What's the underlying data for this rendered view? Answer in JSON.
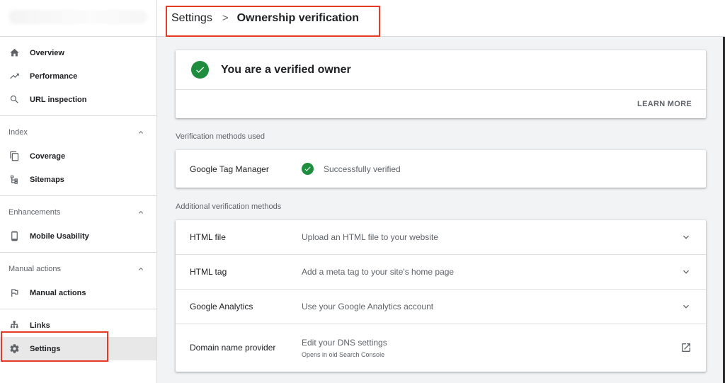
{
  "sidebar": {
    "top_items": [
      {
        "label": "Overview",
        "icon": "home-icon"
      },
      {
        "label": "Performance",
        "icon": "trending-up-icon"
      },
      {
        "label": "URL inspection",
        "icon": "search-icon"
      }
    ],
    "index": {
      "heading": "Index",
      "items": [
        {
          "label": "Coverage",
          "icon": "coverage-icon"
        },
        {
          "label": "Sitemaps",
          "icon": "sitemap-icon"
        }
      ]
    },
    "enhancements": {
      "heading": "Enhancements",
      "items": [
        {
          "label": "Mobile Usability",
          "icon": "mobile-icon"
        }
      ]
    },
    "manual_actions": {
      "heading": "Manual actions",
      "items": [
        {
          "label": "Manual actions",
          "icon": "flag-icon"
        }
      ]
    },
    "bottom_items": [
      {
        "label": "Links",
        "icon": "links-icon"
      },
      {
        "label": "Settings",
        "icon": "gear-icon",
        "active": true
      }
    ]
  },
  "header": {
    "breadcrumb_root": "Settings",
    "breadcrumb_separator": ">",
    "breadcrumb_current": "Ownership verification"
  },
  "owner_card": {
    "title": "You are a verified owner",
    "learn_more": "LEARN MORE"
  },
  "methods_used": {
    "heading": "Verification methods used",
    "items": [
      {
        "name": "Google Tag Manager",
        "status": "Successfully verified"
      }
    ]
  },
  "additional_methods": {
    "heading": "Additional verification methods",
    "items": [
      {
        "name": "HTML file",
        "description": "Upload an HTML file to your website",
        "action_icon": "chevron-down-icon"
      },
      {
        "name": "HTML tag",
        "description": "Add a meta tag to your site's home page",
        "action_icon": "chevron-down-icon"
      },
      {
        "name": "Google Analytics",
        "description": "Use your Google Analytics account",
        "action_icon": "chevron-down-icon"
      },
      {
        "name": "Domain name provider",
        "description": "Edit your DNS settings",
        "subtext": "Opens in old Search Console",
        "action_icon": "open-in-new-icon"
      }
    ]
  },
  "colors": {
    "accent_green": "#1e8e3e",
    "annotation_red": "#e53b26",
    "active_nav_bg": "#e8e8e8"
  }
}
